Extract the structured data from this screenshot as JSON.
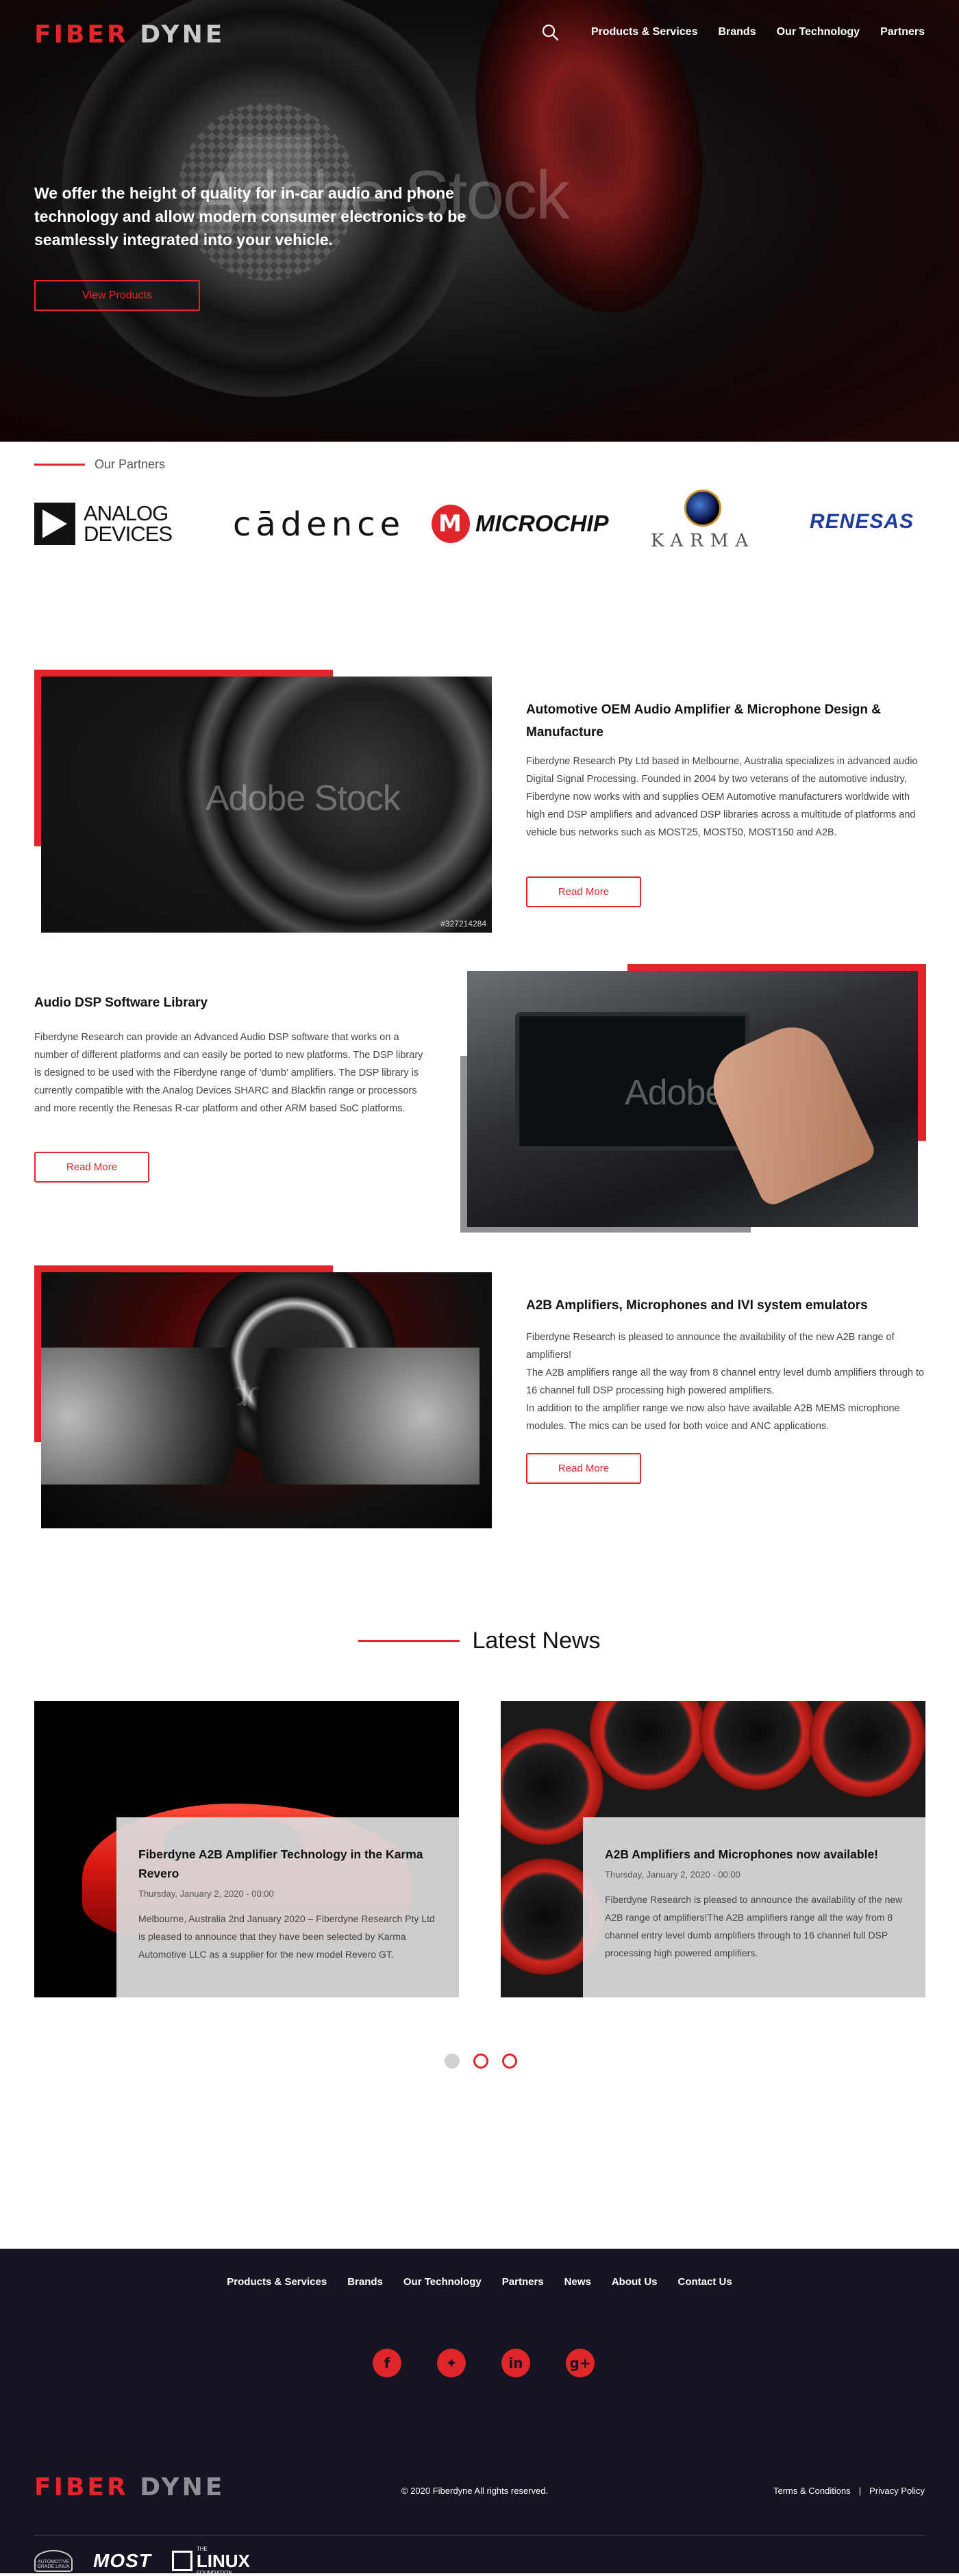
{
  "brand": {
    "part1": "FIBER",
    "part2": "DYNE",
    "accent": "#e0262b",
    "dark": "#141520"
  },
  "nav": [
    "Products & Services",
    "Brands",
    "Our Technology",
    "Partners"
  ],
  "hero": {
    "text": "We offer the height of quality for in-car audio and phone technology and allow modern consumer electronics to be seamlessly integrated into your vehicle.",
    "button": "View Products",
    "watermark": "Adobe Stock"
  },
  "partners": {
    "label": "Our Partners",
    "logos": {
      "analog_line1": "ANALOG",
      "analog_line2": "DEVICES",
      "cadence": "cādence",
      "microchip": "MICROCHIP",
      "karma": "KARMA",
      "renesas": "RENESAS"
    }
  },
  "features": [
    {
      "title": "Automotive OEM Audio Amplifier & Microphone Design & Manufacture",
      "body": "Fiberdyne Research Pty Ltd based in Melbourne, Australia specializes in advanced audio Digital Signal Processing. Founded in 2004 by two veterans of the automotive industry, Fiberdyne now works with and supplies OEM Automotive manufacturers worldwide with high end DSP amplifiers and advanced DSP libraries across a multitude of platforms and vehicle bus networks such as MOST25, MOST50, MOST150 and A2B.",
      "button": "Read More",
      "watermark": "Adobe Stock",
      "stock_id": "#327214284"
    },
    {
      "title": "Audio DSP Software Library",
      "body": "Fiberdyne Research can provide an Advanced Audio DSP software that works on a number of different platforms and can easily be ported to new platforms.  The DSP library is designed to be used with the Fiberdyne range of 'dumb' amplifiers. The DSP library is currently compatible with the Analog Devices SHARC and Blackfin range or processors and more recently the Renesas R-car platform and other ARM based SoC platforms.",
      "button": "Read More",
      "watermark": "Adobe Stock"
    },
    {
      "title": "A2B Amplifiers, Microphones and IVI system emulators",
      "body_lines": [
        "Fiberdyne Research is pleased to announce the availability of the new A2B range of amplifiers!",
        "The A2B amplifiers range all the way from 8 channel entry level dumb amplifiers through to 16 channel full DSP processing high powered amplifiers.",
        "In addition to the amplifier range we now also have available A2B MEMS microphone modules.  The mics can be used for both voice and ANC applications."
      ],
      "button": "Read More",
      "watermark": "Adobe Stock"
    }
  ],
  "news": {
    "heading": "Latest News",
    "items": [
      {
        "title": "Fiberdyne A2B Amplifier Technology in the Karma Revero",
        "date": "Thursday, January 2, 2020 - 00:00",
        "excerpt": "Melbourne, Australia 2nd January 2020 – Fiberdyne Research Pty Ltd is pleased to announce that they have been selected by Karma Automotive LLC as a supplier for the new model Revero GT."
      },
      {
        "title": "A2B Amplifiers and Microphones now available!",
        "date": "Thursday, January 2, 2020 - 00:00",
        "excerpt": "Fiberdyne Research is pleased to announce the availability of the new A2B range of amplifiers!The A2B amplifiers range all the way from 8 channel entry level dumb amplifiers through to 16 channel full DSP processing high powered amplifiers."
      }
    ]
  },
  "footer": {
    "nav": [
      "Products & Services",
      "Brands",
      "Our Technology",
      "Partners",
      "News",
      "About Us",
      "Contact Us"
    ],
    "social": [
      "facebook-icon",
      "twitter-icon",
      "linkedin-icon",
      "googleplus-icon"
    ],
    "copyright": "© 2020  Fiberdyne    All rights reserved.",
    "terms": "Terms & Conditions",
    "separator": "|",
    "privacy": "Privacy Policy",
    "badges": {
      "agl": "AUTOMOTIVE GRADE LINUX",
      "most": "MOST",
      "linux_small": "THE",
      "linux_big": "LINUX",
      "linux_sub": "FOUNDATION"
    }
  }
}
